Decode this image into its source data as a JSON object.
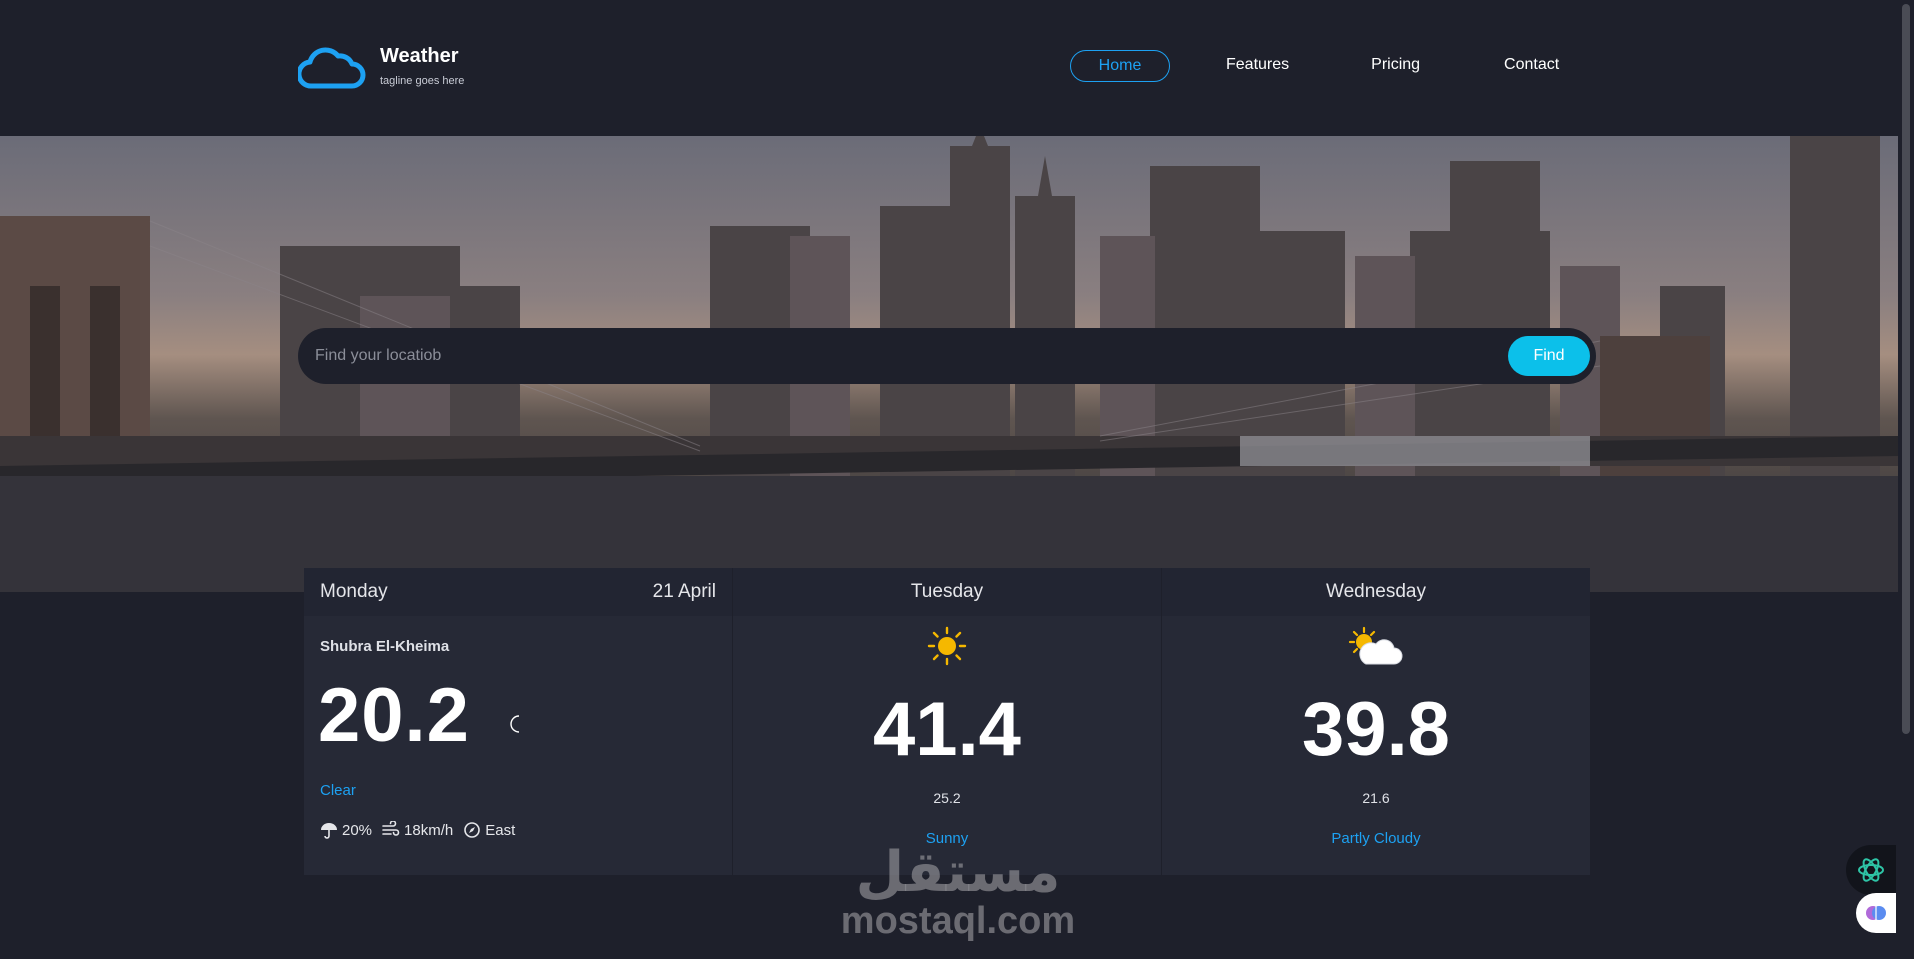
{
  "brand": {
    "title": "Weather",
    "tagline": "tagline goes here",
    "logo_icon": "cloud-icon"
  },
  "nav": {
    "items": [
      {
        "label": "Home",
        "active": true
      },
      {
        "label": "Features",
        "active": false
      },
      {
        "label": "Pricing",
        "active": false
      },
      {
        "label": "Contact",
        "active": false
      }
    ]
  },
  "search": {
    "placeholder": "Find your locatiob",
    "button_label": "Find"
  },
  "today": {
    "day": "Monday",
    "date": "21 April",
    "location": "Shubra El-Kheima",
    "temp": "20.2",
    "condition": "Clear",
    "condition_icon": "moon-icon",
    "rain": "20%",
    "wind_speed": "18km/h",
    "wind_direction": "East"
  },
  "forecast": [
    {
      "day": "Tuesday",
      "temp": "41.4",
      "min": "25.2",
      "condition": "Sunny",
      "icon": "sun-icon"
    },
    {
      "day": "Wednesday",
      "temp": "39.8",
      "min": "21.6",
      "condition": "Partly Cloudy",
      "icon": "partly-cloudy-icon"
    }
  ],
  "watermark": {
    "arabic": "مستقل",
    "latin": "mostaql.com"
  },
  "colors": {
    "background": "#1e202b",
    "card": "#262936",
    "accent": "#1da1f2",
    "button": "#0cc0ea"
  }
}
